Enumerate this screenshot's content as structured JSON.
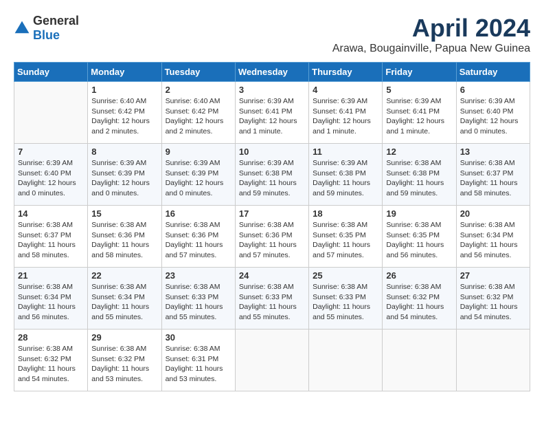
{
  "header": {
    "logo": {
      "general": "General",
      "blue": "Blue"
    },
    "title": "April 2024",
    "location": "Arawa, Bougainville, Papua New Guinea"
  },
  "columns": [
    "Sunday",
    "Monday",
    "Tuesday",
    "Wednesday",
    "Thursday",
    "Friday",
    "Saturday"
  ],
  "weeks": [
    [
      {
        "day": "",
        "sunrise": "",
        "sunset": "",
        "daylight": ""
      },
      {
        "day": "1",
        "sunrise": "Sunrise: 6:40 AM",
        "sunset": "Sunset: 6:42 PM",
        "daylight": "Daylight: 12 hours and 2 minutes."
      },
      {
        "day": "2",
        "sunrise": "Sunrise: 6:40 AM",
        "sunset": "Sunset: 6:42 PM",
        "daylight": "Daylight: 12 hours and 2 minutes."
      },
      {
        "day": "3",
        "sunrise": "Sunrise: 6:39 AM",
        "sunset": "Sunset: 6:41 PM",
        "daylight": "Daylight: 12 hours and 1 minute."
      },
      {
        "day": "4",
        "sunrise": "Sunrise: 6:39 AM",
        "sunset": "Sunset: 6:41 PM",
        "daylight": "Daylight: 12 hours and 1 minute."
      },
      {
        "day": "5",
        "sunrise": "Sunrise: 6:39 AM",
        "sunset": "Sunset: 6:41 PM",
        "daylight": "Daylight: 12 hours and 1 minute."
      },
      {
        "day": "6",
        "sunrise": "Sunrise: 6:39 AM",
        "sunset": "Sunset: 6:40 PM",
        "daylight": "Daylight: 12 hours and 0 minutes."
      }
    ],
    [
      {
        "day": "7",
        "sunrise": "Sunrise: 6:39 AM",
        "sunset": "Sunset: 6:40 PM",
        "daylight": "Daylight: 12 hours and 0 minutes."
      },
      {
        "day": "8",
        "sunrise": "Sunrise: 6:39 AM",
        "sunset": "Sunset: 6:39 PM",
        "daylight": "Daylight: 12 hours and 0 minutes."
      },
      {
        "day": "9",
        "sunrise": "Sunrise: 6:39 AM",
        "sunset": "Sunset: 6:39 PM",
        "daylight": "Daylight: 12 hours and 0 minutes."
      },
      {
        "day": "10",
        "sunrise": "Sunrise: 6:39 AM",
        "sunset": "Sunset: 6:38 PM",
        "daylight": "Daylight: 11 hours and 59 minutes."
      },
      {
        "day": "11",
        "sunrise": "Sunrise: 6:39 AM",
        "sunset": "Sunset: 6:38 PM",
        "daylight": "Daylight: 11 hours and 59 minutes."
      },
      {
        "day": "12",
        "sunrise": "Sunrise: 6:38 AM",
        "sunset": "Sunset: 6:38 PM",
        "daylight": "Daylight: 11 hours and 59 minutes."
      },
      {
        "day": "13",
        "sunrise": "Sunrise: 6:38 AM",
        "sunset": "Sunset: 6:37 PM",
        "daylight": "Daylight: 11 hours and 58 minutes."
      }
    ],
    [
      {
        "day": "14",
        "sunrise": "Sunrise: 6:38 AM",
        "sunset": "Sunset: 6:37 PM",
        "daylight": "Daylight: 11 hours and 58 minutes."
      },
      {
        "day": "15",
        "sunrise": "Sunrise: 6:38 AM",
        "sunset": "Sunset: 6:36 PM",
        "daylight": "Daylight: 11 hours and 58 minutes."
      },
      {
        "day": "16",
        "sunrise": "Sunrise: 6:38 AM",
        "sunset": "Sunset: 6:36 PM",
        "daylight": "Daylight: 11 hours and 57 minutes."
      },
      {
        "day": "17",
        "sunrise": "Sunrise: 6:38 AM",
        "sunset": "Sunset: 6:36 PM",
        "daylight": "Daylight: 11 hours and 57 minutes."
      },
      {
        "day": "18",
        "sunrise": "Sunrise: 6:38 AM",
        "sunset": "Sunset: 6:35 PM",
        "daylight": "Daylight: 11 hours and 57 minutes."
      },
      {
        "day": "19",
        "sunrise": "Sunrise: 6:38 AM",
        "sunset": "Sunset: 6:35 PM",
        "daylight": "Daylight: 11 hours and 56 minutes."
      },
      {
        "day": "20",
        "sunrise": "Sunrise: 6:38 AM",
        "sunset": "Sunset: 6:34 PM",
        "daylight": "Daylight: 11 hours and 56 minutes."
      }
    ],
    [
      {
        "day": "21",
        "sunrise": "Sunrise: 6:38 AM",
        "sunset": "Sunset: 6:34 PM",
        "daylight": "Daylight: 11 hours and 56 minutes."
      },
      {
        "day": "22",
        "sunrise": "Sunrise: 6:38 AM",
        "sunset": "Sunset: 6:34 PM",
        "daylight": "Daylight: 11 hours and 55 minutes."
      },
      {
        "day": "23",
        "sunrise": "Sunrise: 6:38 AM",
        "sunset": "Sunset: 6:33 PM",
        "daylight": "Daylight: 11 hours and 55 minutes."
      },
      {
        "day": "24",
        "sunrise": "Sunrise: 6:38 AM",
        "sunset": "Sunset: 6:33 PM",
        "daylight": "Daylight: 11 hours and 55 minutes."
      },
      {
        "day": "25",
        "sunrise": "Sunrise: 6:38 AM",
        "sunset": "Sunset: 6:33 PM",
        "daylight": "Daylight: 11 hours and 55 minutes."
      },
      {
        "day": "26",
        "sunrise": "Sunrise: 6:38 AM",
        "sunset": "Sunset: 6:32 PM",
        "daylight": "Daylight: 11 hours and 54 minutes."
      },
      {
        "day": "27",
        "sunrise": "Sunrise: 6:38 AM",
        "sunset": "Sunset: 6:32 PM",
        "daylight": "Daylight: 11 hours and 54 minutes."
      }
    ],
    [
      {
        "day": "28",
        "sunrise": "Sunrise: 6:38 AM",
        "sunset": "Sunset: 6:32 PM",
        "daylight": "Daylight: 11 hours and 54 minutes."
      },
      {
        "day": "29",
        "sunrise": "Sunrise: 6:38 AM",
        "sunset": "Sunset: 6:32 PM",
        "daylight": "Daylight: 11 hours and 53 minutes."
      },
      {
        "day": "30",
        "sunrise": "Sunrise: 6:38 AM",
        "sunset": "Sunset: 6:31 PM",
        "daylight": "Daylight: 11 hours and 53 minutes."
      },
      {
        "day": "",
        "sunrise": "",
        "sunset": "",
        "daylight": ""
      },
      {
        "day": "",
        "sunrise": "",
        "sunset": "",
        "daylight": ""
      },
      {
        "day": "",
        "sunrise": "",
        "sunset": "",
        "daylight": ""
      },
      {
        "day": "",
        "sunrise": "",
        "sunset": "",
        "daylight": ""
      }
    ]
  ]
}
